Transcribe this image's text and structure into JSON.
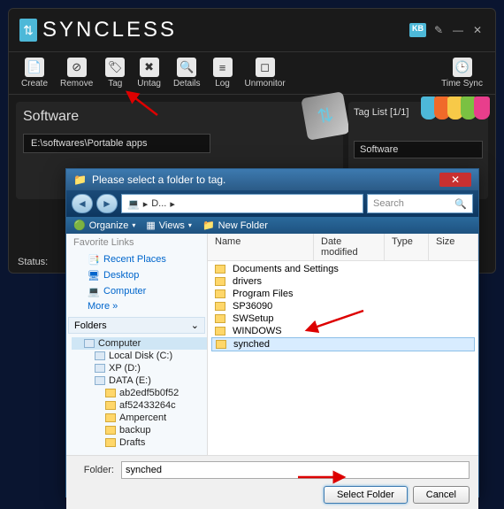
{
  "app": {
    "name": "SYNCLESS",
    "titlebar_kb": "KB",
    "toolbar": [
      {
        "label": "Create",
        "icon": "📄"
      },
      {
        "label": "Remove",
        "icon": "⊘"
      },
      {
        "label": "Tag",
        "icon": "🏷"
      },
      {
        "label": "Untag",
        "icon": "✖"
      },
      {
        "label": "Details",
        "icon": "🔍"
      },
      {
        "label": "Log",
        "icon": "≡"
      },
      {
        "label": "Unmonitor",
        "icon": "◻"
      }
    ],
    "time_sync": "Time Sync",
    "panel_title": "Software",
    "path": "E:\\softwares\\Portable apps",
    "taglist_title": "Tag List [1/1]",
    "taglist_item": "Software",
    "status_label": "Status:"
  },
  "dialog": {
    "title": "Please select a folder to tag.",
    "addr": "D...",
    "search_placeholder": "Search",
    "tb_organize": "Organize",
    "tb_views": "Views",
    "tb_newfolder": "New Folder",
    "fav_head": "Favorite Links",
    "fav": [
      "Recent Places",
      "Desktop",
      "Computer"
    ],
    "more": "More  »",
    "folders_label": "Folders",
    "tree": [
      {
        "label": "Computer",
        "indent": 0,
        "icon": "d",
        "sel": true
      },
      {
        "label": "Local Disk (C:)",
        "indent": 1,
        "icon": "d"
      },
      {
        "label": "XP (D:)",
        "indent": 1,
        "icon": "d"
      },
      {
        "label": "DATA (E:)",
        "indent": 1,
        "icon": "d"
      },
      {
        "label": "ab2edf5b0f52",
        "indent": 2,
        "icon": "f"
      },
      {
        "label": "af52433264c",
        "indent": 2,
        "icon": "f"
      },
      {
        "label": "Ampercent",
        "indent": 2,
        "icon": "f"
      },
      {
        "label": "backup",
        "indent": 2,
        "icon": "f"
      },
      {
        "label": "Drafts",
        "indent": 2,
        "icon": "f"
      }
    ],
    "columns": [
      "Name",
      "Date modified",
      "Type",
      "Size"
    ],
    "files": [
      {
        "name": "Documents and Settings"
      },
      {
        "name": "drivers"
      },
      {
        "name": "Program Files"
      },
      {
        "name": "SP36090"
      },
      {
        "name": "SWSetup"
      },
      {
        "name": "WINDOWS"
      },
      {
        "name": "synched",
        "sel": true
      }
    ],
    "folder_label": "Folder:",
    "folder_value": "synched",
    "btn_select": "Select Folder",
    "btn_cancel": "Cancel"
  },
  "colors": {
    "tags": [
      "#4db8d8",
      "#f06a2a",
      "#f7c948",
      "#7ac142",
      "#e83e8c"
    ]
  }
}
